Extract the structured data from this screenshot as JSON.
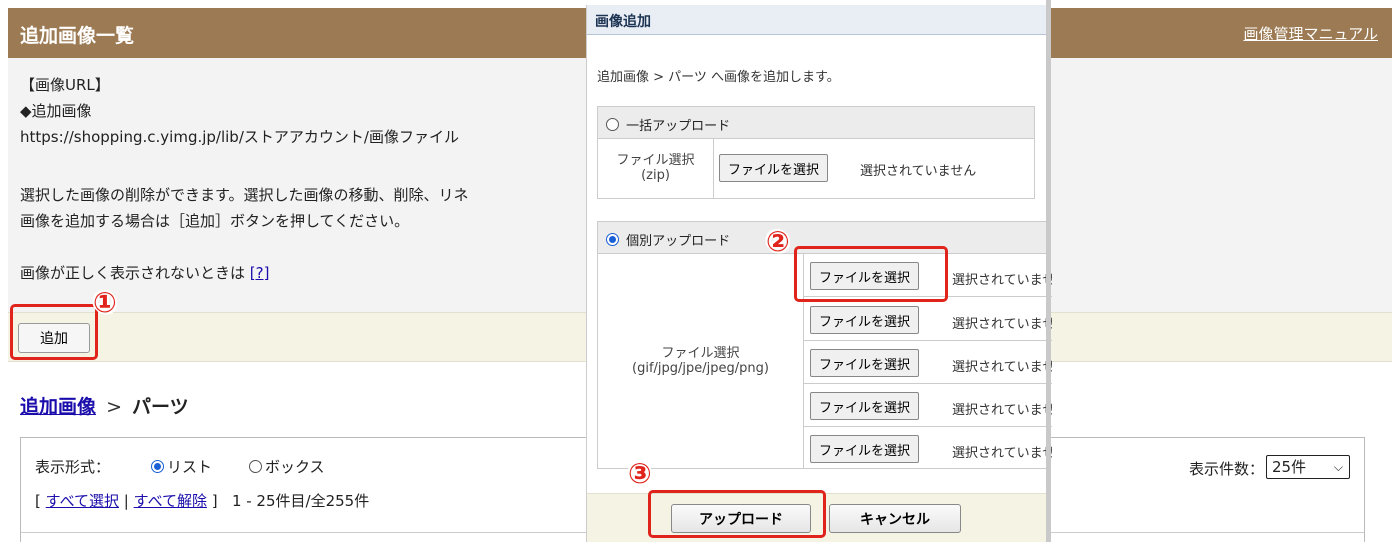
{
  "header": {
    "title": "追加画像一覧",
    "manual_link": "画像管理マニュアル"
  },
  "description": {
    "url_heading": "【画像URL】",
    "added_images": "◆追加画像",
    "url": "https://shopping.c.yimg.jp/lib/ストアアカウント/画像ファイル",
    "delete_note": "選択した画像の削除ができます。選択した画像の移動、削除、リネ",
    "add_note": "画像を追加する場合は［追加］ボタンを押してください。",
    "trouble_note": "画像が正しく表示されないときは",
    "help_link": "[?]"
  },
  "add_button": "追加",
  "breadcrumb": {
    "link": "追加画像",
    "separator": ">",
    "current": "パーツ"
  },
  "list_panel": {
    "view_label": "表示形式：",
    "view_options": [
      "リスト",
      "ボックス"
    ],
    "view_selected": "リスト",
    "select_open": "[",
    "select_all": "すべて選択",
    "select_divider": "|",
    "deselect_all": "すべて解除",
    "select_close": "]",
    "range_text": "1 - 25件目/全255件",
    "count_label": "表示件数：",
    "count_value": "25件"
  },
  "modal": {
    "title": "画像追加",
    "intro": "追加画像 > パーツ へ画像を追加します。",
    "bulk": {
      "option_label": "一括アップロード",
      "selected": false,
      "file_label_line1": "ファイル選択",
      "file_label_line2": "(zip)",
      "button": "ファイルを選択",
      "status": "選択されていません"
    },
    "individual": {
      "option_label": "個別アップロード",
      "selected": true,
      "file_label_line1": "ファイル選択",
      "file_label_line2": "(gif/jpg/jpe/jpeg/png)",
      "rows": [
        {
          "button": "ファイルを選択",
          "status": "選択されていません"
        },
        {
          "button": "ファイルを選択",
          "status": "選択されていません"
        },
        {
          "button": "ファイルを選択",
          "status": "選択されていません"
        },
        {
          "button": "ファイルを選択",
          "status": "選択されていません"
        },
        {
          "button": "ファイルを選択",
          "status": "選択されていません"
        }
      ]
    },
    "upload_button": "アップロード",
    "cancel_button": "キャンセル"
  },
  "callouts": [
    "①",
    "②",
    "③"
  ],
  "colors": {
    "header_bg": "#9c7a53",
    "highlight": "#e0241b",
    "link": "#1a0dab",
    "radio_selected": "#1a5fd6"
  }
}
